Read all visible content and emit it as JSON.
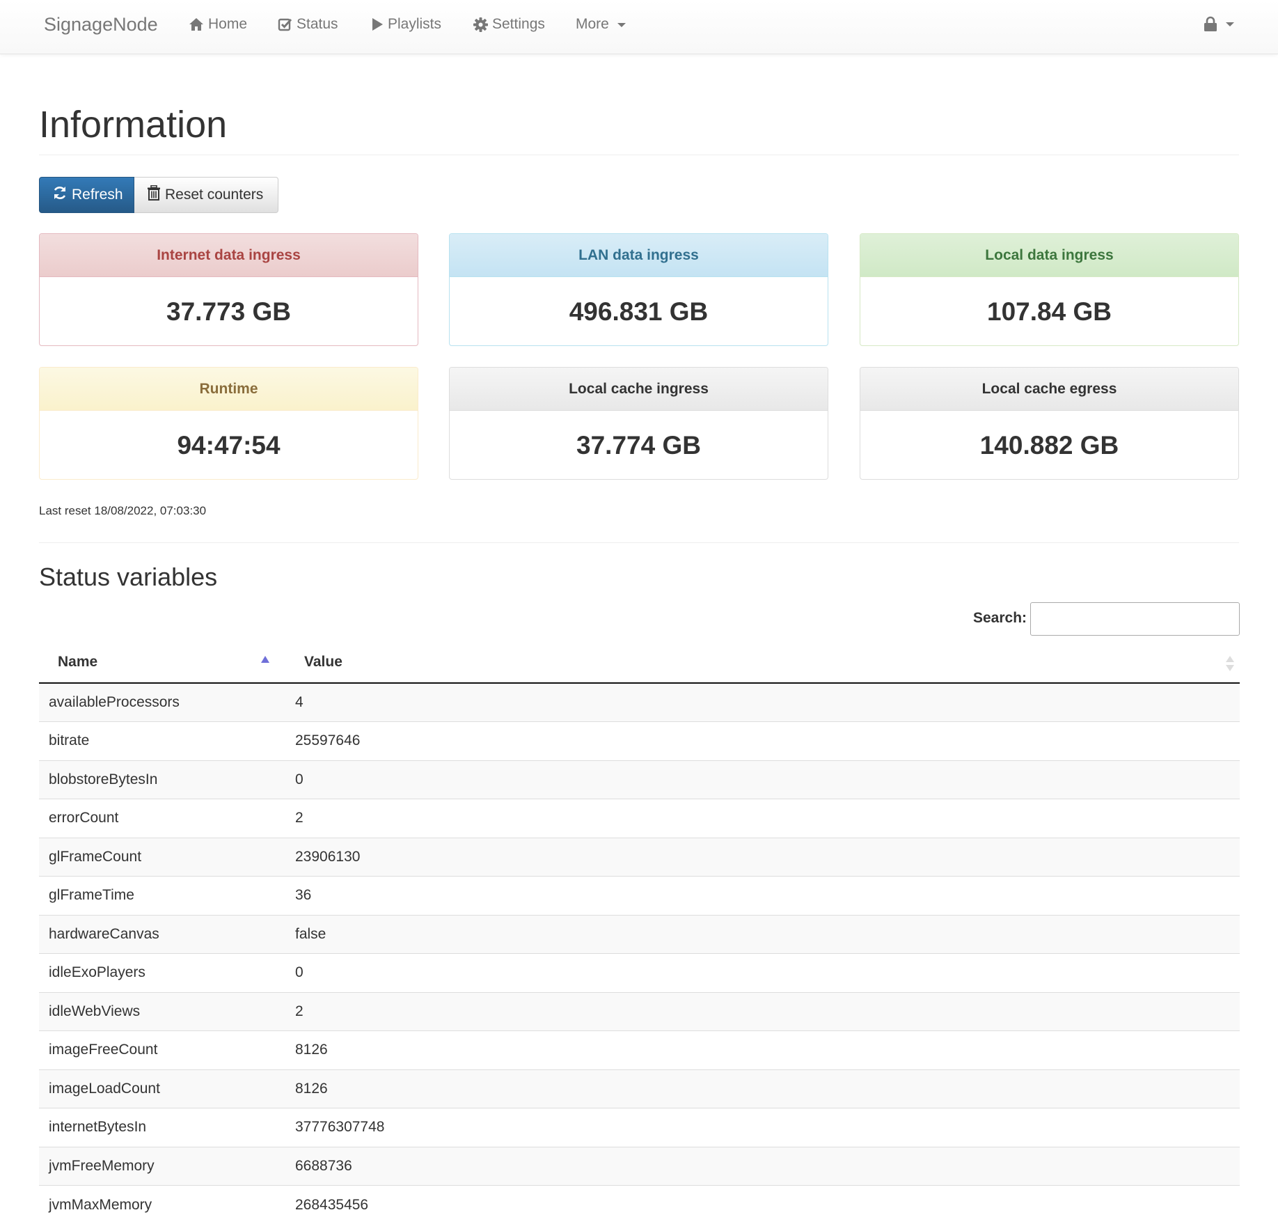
{
  "navbar": {
    "brand": "SignageNode",
    "items": [
      {
        "label": "Home",
        "icon": "home-icon"
      },
      {
        "label": "Status",
        "icon": "check-square-icon"
      },
      {
        "label": "Playlists",
        "icon": "play-icon"
      },
      {
        "label": "Settings",
        "icon": "gear-icon"
      }
    ],
    "more_label": "More",
    "user_icon": "lock-icon"
  },
  "page": {
    "title": "Information"
  },
  "actions": {
    "refresh_label": "Refresh",
    "reset_label": "Reset counters"
  },
  "panels": [
    {
      "title": "Internet data ingress",
      "value": "37.773 GB",
      "style": "danger"
    },
    {
      "title": "LAN data ingress",
      "value": "496.831 GB",
      "style": "info"
    },
    {
      "title": "Local data ingress",
      "value": "107.84 GB",
      "style": "success"
    },
    {
      "title": "Runtime",
      "value": "94:47:54",
      "style": "warning"
    },
    {
      "title": "Local cache ingress",
      "value": "37.774 GB",
      "style": "default"
    },
    {
      "title": "Local cache egress",
      "value": "140.882 GB",
      "style": "default"
    }
  ],
  "last_reset": "Last reset 18/08/2022, 07:03:30",
  "status": {
    "title": "Status variables",
    "search_label": "Search:",
    "search_value": "",
    "columns": [
      "Name",
      "Value"
    ],
    "sort": "Name ascending",
    "rows": [
      {
        "name": "availableProcessors",
        "value": "4"
      },
      {
        "name": "bitrate",
        "value": "25597646"
      },
      {
        "name": "blobstoreBytesIn",
        "value": "0"
      },
      {
        "name": "errorCount",
        "value": "2"
      },
      {
        "name": "glFrameCount",
        "value": "23906130"
      },
      {
        "name": "glFrameTime",
        "value": "36"
      },
      {
        "name": "hardwareCanvas",
        "value": "false"
      },
      {
        "name": "idleExoPlayers",
        "value": "0"
      },
      {
        "name": "idleWebViews",
        "value": "2"
      },
      {
        "name": "imageFreeCount",
        "value": "8126"
      },
      {
        "name": "imageLoadCount",
        "value": "8126"
      },
      {
        "name": "internetBytesIn",
        "value": "37776307748"
      },
      {
        "name": "jvmFreeMemory",
        "value": "6688736"
      },
      {
        "name": "jvmMaxMemory",
        "value": "268435456"
      }
    ]
  },
  "colors": {
    "primary": "#337ab7",
    "danger_text": "#a94442",
    "info_text": "#31708f",
    "success_text": "#3c763d",
    "warning_text": "#8a6d3b",
    "sort_active": "#6f6fd8"
  }
}
